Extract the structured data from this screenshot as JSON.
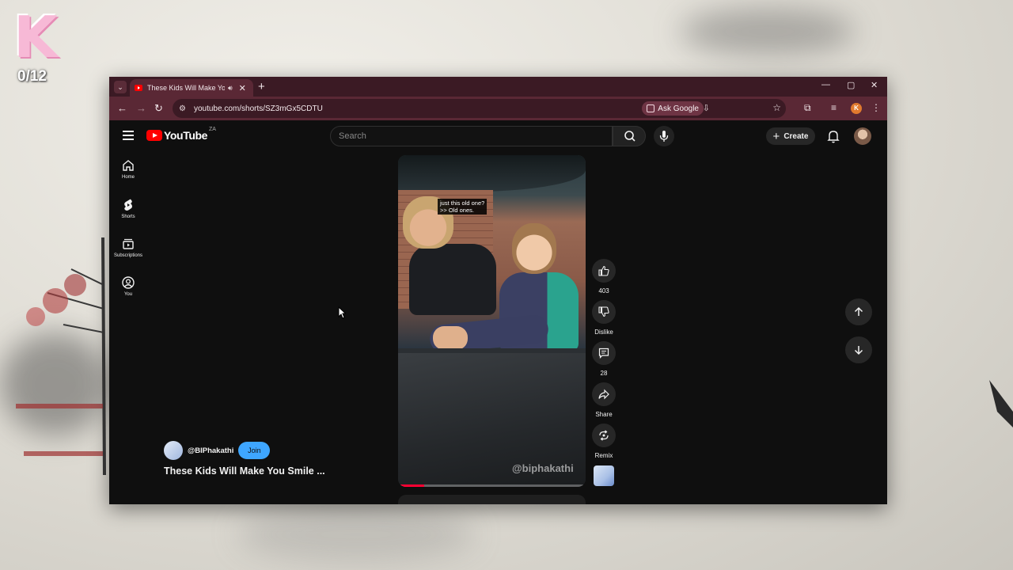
{
  "desktop": {
    "logo_letter": "K",
    "counter": "0/12"
  },
  "browser": {
    "tab": {
      "title": "These Kids Will Make You Smile"
    },
    "address_bar": {
      "url": "youtube.com/shorts/SZ3mGx5CDTU",
      "ask_google_label": "Ask Google"
    },
    "profile_initial": "K"
  },
  "youtube": {
    "logo_text": "YouTube",
    "country_code": "ZA",
    "search": {
      "placeholder": "Search"
    },
    "create_label": "Create",
    "sidebar": {
      "items": [
        {
          "label": "Home",
          "icon": "home-icon"
        },
        {
          "label": "Shorts",
          "icon": "shorts-icon"
        },
        {
          "label": "Subscriptions",
          "icon": "subscriptions-icon"
        },
        {
          "label": "You",
          "icon": "you-icon"
        }
      ]
    },
    "short": {
      "caption_line1": "just this old one?",
      "caption_line2": ">> Old ones.",
      "watermark": "@biphakathi",
      "progress": 0.14,
      "channel_name": "@BIPhakathi",
      "join_label": "Join",
      "title": "These Kids Will Make You Smile ..."
    },
    "actions": {
      "like_count": "403",
      "dislike_label": "Dislike",
      "comment_count": "28",
      "share_label": "Share",
      "remix_label": "Remix"
    }
  }
}
